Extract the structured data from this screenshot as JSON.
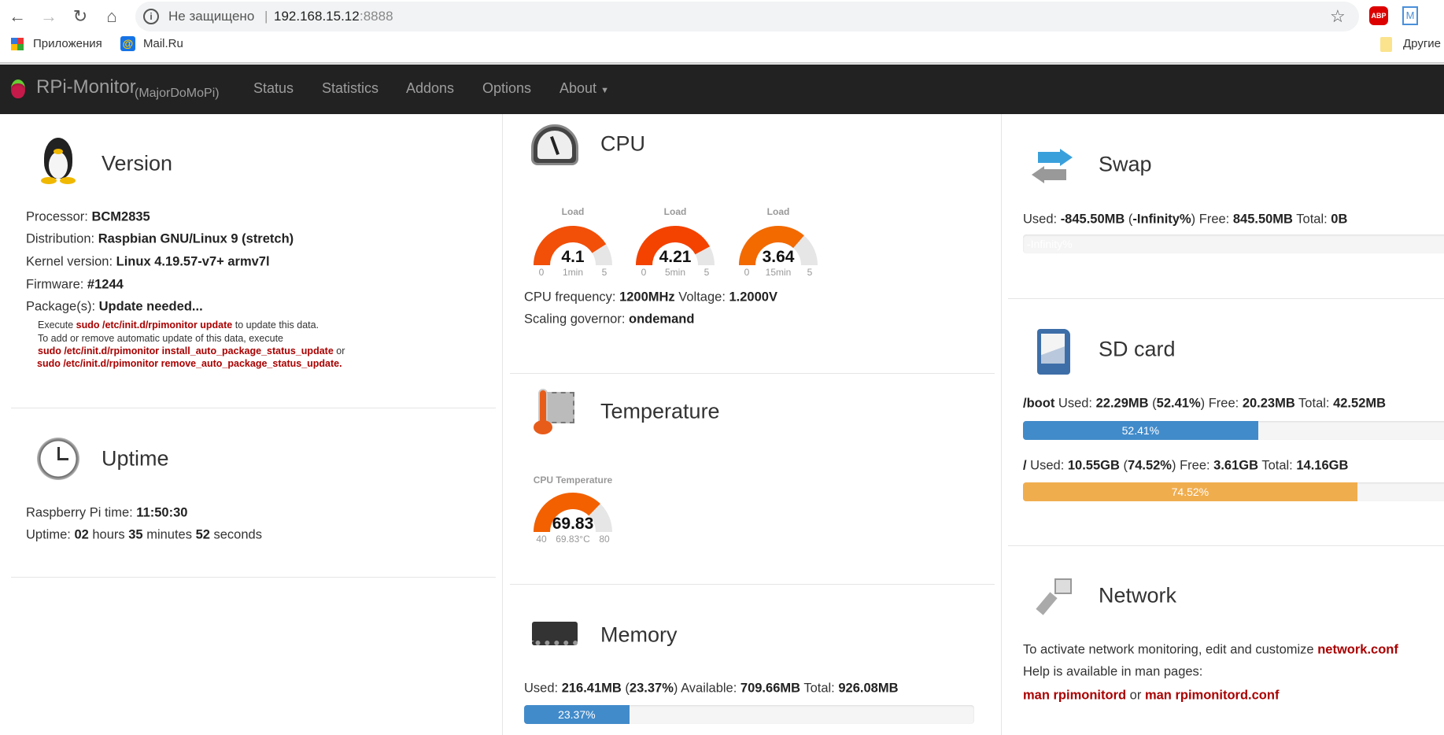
{
  "browser": {
    "security": "Не защищено",
    "url_host": "192.168.15.12",
    "url_port": ":8888",
    "bookmarks": [
      {
        "label": "Приложения",
        "icon": "apps-grid-icon"
      },
      {
        "label": "Mail.Ru",
        "icon": "mailru-icon"
      }
    ],
    "other_bookmarks": "Другие",
    "extensions": [
      "ABP",
      "M"
    ]
  },
  "navbar": {
    "brand": "RPi-Monitor",
    "hostname": "(MajorDoMoPi)",
    "items": [
      "Status",
      "Statistics",
      "Addons",
      "Options",
      "About"
    ]
  },
  "version": {
    "title": "Version",
    "rows": [
      {
        "label": "Processor: ",
        "value": "BCM2835"
      },
      {
        "label": "Distribution: ",
        "value": "Raspbian GNU/Linux 9 (stretch)"
      },
      {
        "label": "Kernel version: ",
        "value": "Linux 4.19.57-v7+ armv7l"
      },
      {
        "label": "Firmware: ",
        "value": "#1244"
      },
      {
        "label": "Package(s): ",
        "value": "Update needed..."
      }
    ],
    "note": {
      "l1a": "Execute ",
      "l1b": "sudo /etc/init.d/rpimonitor update",
      "l1c": " to update this data.",
      "l2": "To add or remove automatic update of this data, execute",
      "l3a": "sudo /etc/init.d/rpimonitor install_auto_package_status_update",
      "l3b": " or",
      "l4": "sudo /etc/init.d/rpimonitor remove_auto_package_status_update."
    }
  },
  "uptime": {
    "title": "Uptime",
    "pi_time_label": "Raspberry Pi time: ",
    "pi_time": "11:50:30",
    "uptime_label": "Uptime: ",
    "hours": "02",
    "hours_label": " hours ",
    "minutes": "35",
    "minutes_label": " minutes ",
    "seconds": "52",
    "seconds_label": " seconds"
  },
  "cpu": {
    "title": "CPU",
    "gauges": [
      {
        "title": "Load",
        "value": "4.1",
        "num": 4.1,
        "min": "0",
        "max": "5",
        "sub": "1min",
        "color": "#f24f08"
      },
      {
        "title": "Load",
        "value": "4.21",
        "num": 4.21,
        "min": "0",
        "max": "5",
        "sub": "5min",
        "color": "#f44200"
      },
      {
        "title": "Load",
        "value": "3.64",
        "num": 3.64,
        "min": "0",
        "max": "5",
        "sub": "15min",
        "color": "#f26a00"
      }
    ],
    "freq_label": "CPU frequency: ",
    "freq": "1200MHz",
    "volt_label": " Voltage: ",
    "volt": "1.2000V",
    "gov_label": "Scaling governor: ",
    "gov": "ondemand"
  },
  "temperature": {
    "title": "Temperature",
    "gauge": {
      "title": "CPU Temperature",
      "value": "69.83",
      "num": 69.83,
      "min": "40",
      "max": "80",
      "sub": "69.83°C",
      "color": "#f26000"
    }
  },
  "memory": {
    "title": "Memory",
    "used_label": "Used: ",
    "used": "216.41MB",
    "pct": "23.37%",
    "avail_label": " Available: ",
    "avail": "709.66MB",
    "total_label": " Total: ",
    "total": "926.08MB",
    "fraction": 0.2337,
    "color": "#428bca"
  },
  "swap": {
    "title": "Swap",
    "used_label": "Used: ",
    "used": "-845.50MB",
    "pct": "-Infinity%",
    "free_label": " Free: ",
    "free": "845.50MB",
    "total_label": " Total: ",
    "total": "0B"
  },
  "sdcard": {
    "title": "SD card",
    "mounts": [
      {
        "name": "/boot",
        "used": "22.29MB",
        "pct": "52.41%",
        "free": "20.23MB",
        "total": "42.52MB",
        "fraction": 0.5241,
        "color": "#428bca"
      },
      {
        "name": "/",
        "used": "10.55GB",
        "pct": "74.52%",
        "free": "3.61GB",
        "total": "14.16GB",
        "fraction": 0.7452,
        "color": "#f0ad4e"
      }
    ],
    "used_label": " Used: ",
    "free_label": " Free: ",
    "total_label": " Total: "
  },
  "network": {
    "title": "Network",
    "l1": "To activate network monitoring, edit and customize ",
    "l1_link": "network.conf",
    "l2": "Help is available in man pages:",
    "link1": "man rpimonitord",
    "or": " or ",
    "link2": "man rpimonitord.conf"
  }
}
